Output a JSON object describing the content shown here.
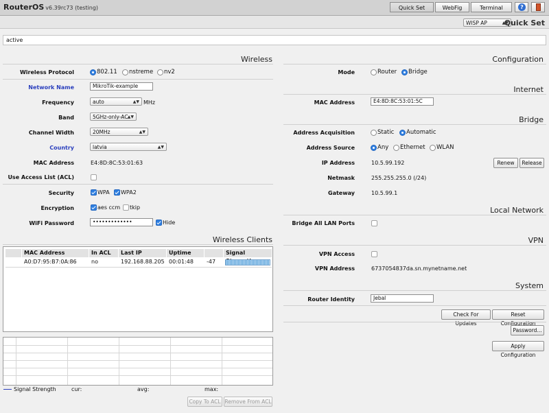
{
  "app": {
    "title": "RouterOS",
    "version": "v6.39rc73 (testing)"
  },
  "toolbar": {
    "quick_set": "Quick Set",
    "webfig": "WebFig",
    "terminal": "Terminal"
  },
  "subbar": {
    "mode_select": "WISP AP",
    "page_title": "Quick Set"
  },
  "status": "active",
  "wireless": {
    "title": "Wireless",
    "protocol_label": "Wireless Protocol",
    "protocol_options": [
      "802.11",
      "nstreme",
      "nv2"
    ],
    "network_name_label": "Network Name",
    "network_name": "MikroTik-example",
    "frequency_label": "Frequency",
    "frequency": "auto",
    "frequency_unit": "MHz",
    "band_label": "Band",
    "band": "5GHz-only-AC",
    "channel_width_label": "Channel Width",
    "channel_width": "20MHz",
    "country_label": "Country",
    "country": "latvia",
    "mac_label": "MAC Address",
    "mac": "E4:8D:8C:53:01:63",
    "acl_label": "Use Access List (ACL)",
    "security_label": "Security",
    "wpa": "WPA",
    "wpa2": "WPA2",
    "encryption_label": "Encryption",
    "aes": "aes ccm",
    "tkip": "tkip",
    "password_label": "WiFi Password",
    "password": "•••••••••••••",
    "hide": "Hide"
  },
  "clients": {
    "title": "Wireless Clients",
    "headers": [
      "MAC Address",
      "In ACL",
      "Last IP",
      "Uptime",
      "",
      "Signal Strength"
    ],
    "rows": [
      {
        "mac": "A0:D7:95:B7:0A:86",
        "in_acl": "no",
        "last_ip": "192.168.88.205",
        "uptime": "00:01:48",
        "signal": "-47"
      }
    ],
    "legend": "Signal Strength",
    "cur": "cur:",
    "avg": "avg:",
    "max": "max:",
    "copy_acl": "Copy To ACL",
    "remove_acl": "Remove From ACL"
  },
  "configuration": {
    "title": "Configuration",
    "mode_label": "Mode",
    "mode_router": "Router",
    "mode_bridge": "Bridge"
  },
  "internet": {
    "title": "Internet",
    "mac_label": "MAC Address",
    "mac": "E4:8D:8C:53:01:5C"
  },
  "bridge": {
    "title": "Bridge",
    "acq_label": "Address Acquisition",
    "acq_static": "Static",
    "acq_auto": "Automatic",
    "source_label": "Address Source",
    "source_any": "Any",
    "source_ethernet": "Ethernet",
    "source_wlan": "WLAN",
    "ip_label": "IP Address",
    "ip": "10.5.99.192",
    "renew": "Renew",
    "release": "Release",
    "netmask_label": "Netmask",
    "netmask": "255.255.255.0 (/24)",
    "gateway_label": "Gateway",
    "gateway": "10.5.99.1"
  },
  "local_network": {
    "title": "Local Network",
    "bridge_ports_label": "Bridge All LAN Ports"
  },
  "vpn": {
    "title": "VPN",
    "access_label": "VPN Access",
    "address_label": "VPN Address",
    "address": "6737054837da.sn.mynetname.net"
  },
  "system": {
    "title": "System",
    "identity_label": "Router Identity",
    "identity": "Jebal",
    "check_updates": "Check For Updates",
    "reset_config": "Reset Configuration",
    "password": "Password...",
    "apply": "Apply Configuration"
  },
  "colors": {
    "accent": "#2f7fe0",
    "label_blue": "#2a3fbd",
    "meter": "#4a9bd8"
  }
}
